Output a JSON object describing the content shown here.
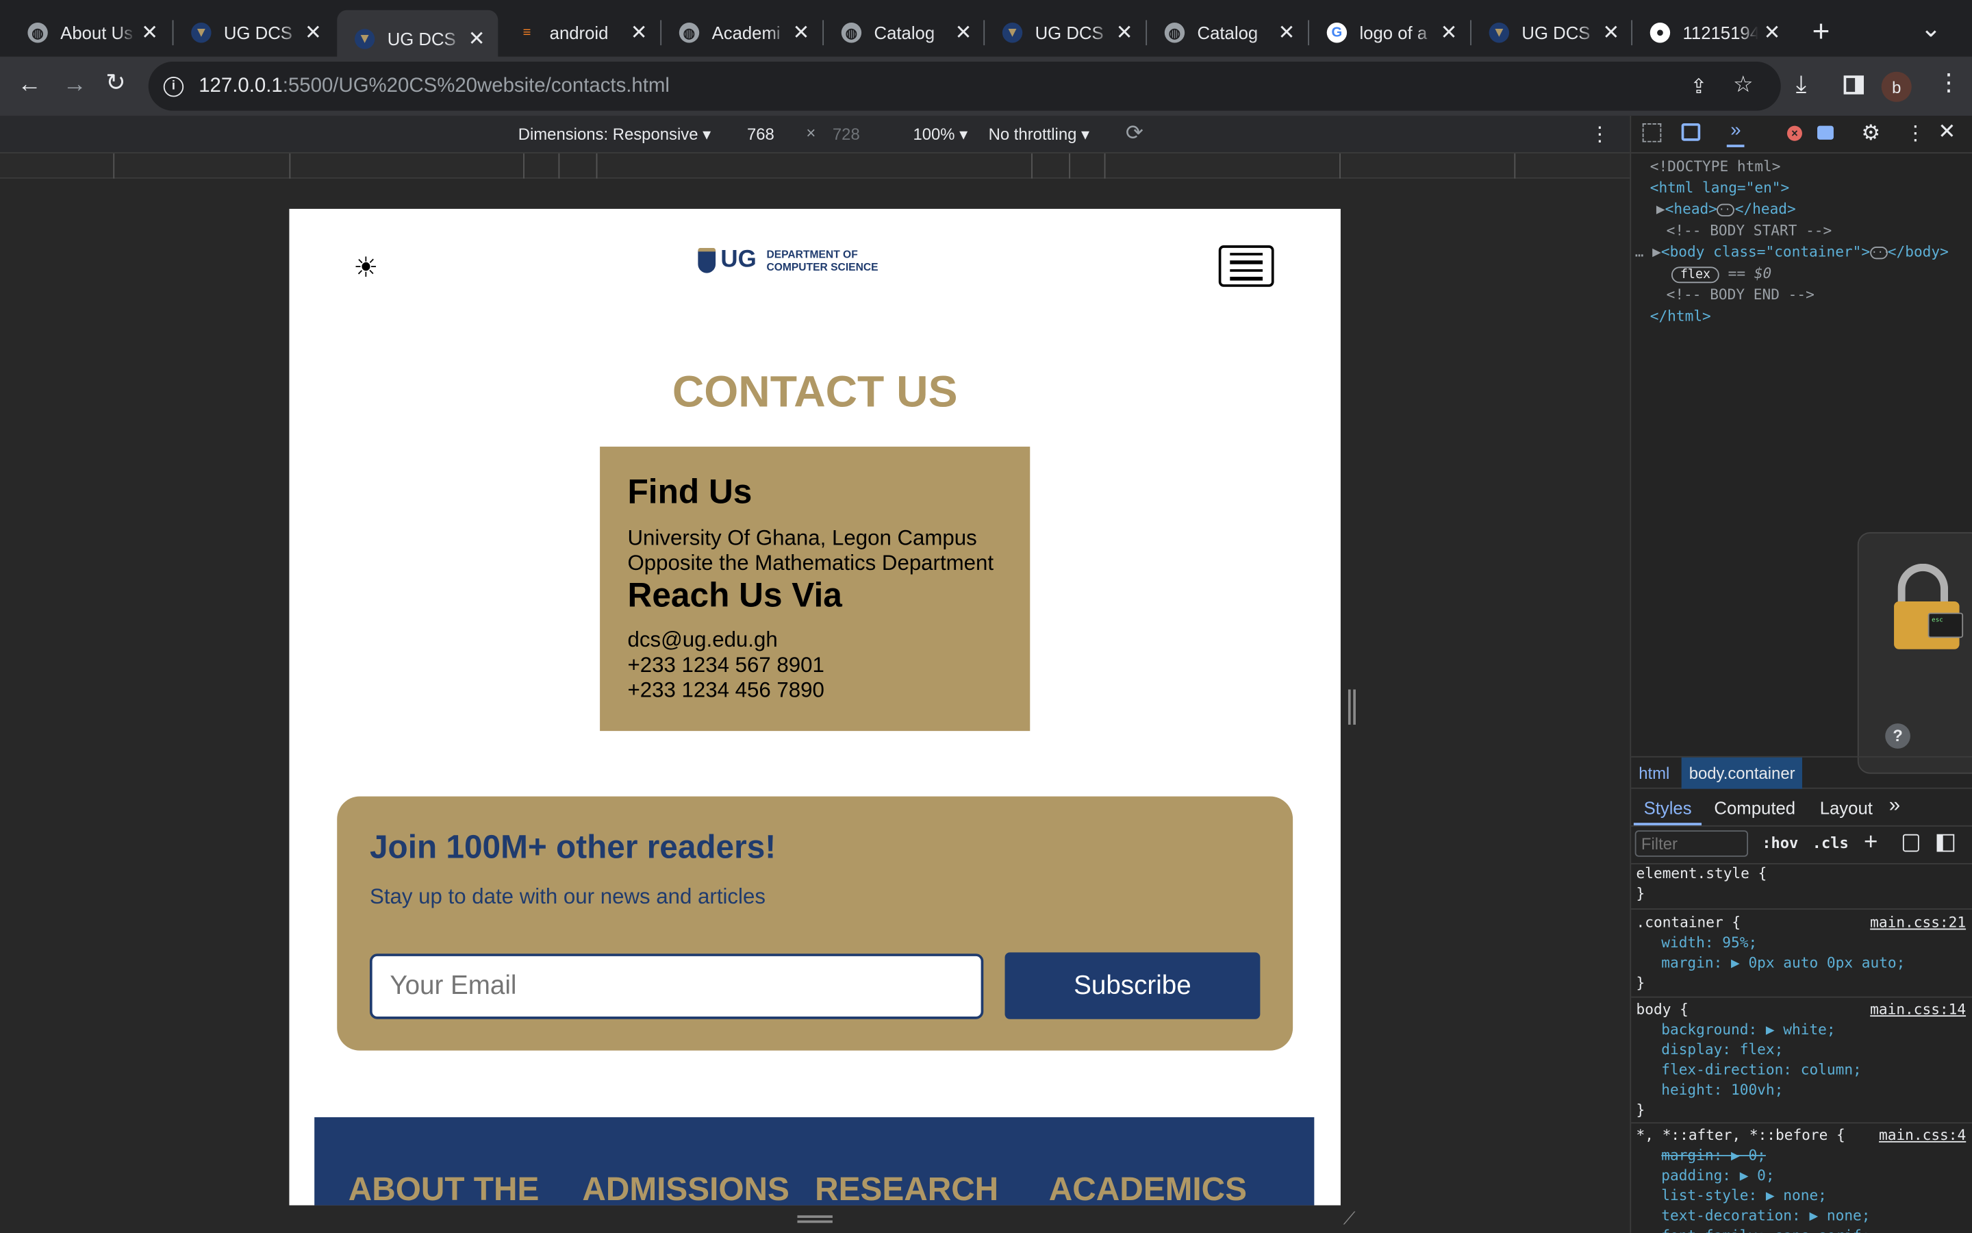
{
  "browser": {
    "tabs": [
      {
        "title": "About Us",
        "icon": "globe-icon"
      },
      {
        "title": "UG DCS",
        "icon": "ug-crest-icon"
      },
      {
        "title": "UG DCS",
        "icon": "ug-crest-icon",
        "active": true
      },
      {
        "title": "android",
        "icon": "stackoverflow-icon"
      },
      {
        "title": "Academi",
        "icon": "globe-icon"
      },
      {
        "title": "Catalog",
        "icon": "globe-icon"
      },
      {
        "title": "UG DCS",
        "icon": "ug-crest-icon"
      },
      {
        "title": "Catalog",
        "icon": "globe-icon"
      },
      {
        "title": "logo of a",
        "icon": "google-icon"
      },
      {
        "title": "UG DCS",
        "icon": "ug-crest-icon"
      },
      {
        "title": "11215194",
        "icon": "github-icon"
      }
    ],
    "url_host": "127.0.0.1",
    "url_path": ":5500/UG%20CS%20website/contacts.html",
    "profile_initial": "b"
  },
  "device_toolbar": {
    "dimensions_label": "Dimensions: Responsive",
    "width": "768",
    "times": "×",
    "height": "728",
    "zoom": "100%",
    "throttling": "No throttling"
  },
  "page": {
    "logo_text": "UG",
    "logo_sub_line1": "DEPARTMENT OF",
    "logo_sub_line2": "COMPUTER SCIENCE",
    "heading": "CONTACT US",
    "find_us_title": "Find Us",
    "address_line1": "University Of Ghana, Legon Campus",
    "address_line2": "Opposite the Mathematics Department",
    "reach_title": "Reach Us Via",
    "email": "dcs@ug.edu.gh",
    "phone1": "+233 1234 567 8901",
    "phone2": "+233 1234 456 7890",
    "newsletter_title": "Join 100M+ other readers!",
    "newsletter_sub": "Stay up to date with our news and articles",
    "email_placeholder": "Your Email",
    "subscribe_label": "Subscribe",
    "footer_links": [
      "ABOUT THE",
      "ADMISSIONS",
      "RESEARCH",
      "ACADEMICS"
    ],
    "colors": {
      "gold": "#b09865",
      "navy": "#1f3b6e",
      "white": "#ffffff"
    }
  },
  "devtools": {
    "elements": [
      "<!DOCTYPE html>",
      "<html lang=\"en\">",
      "<head>",
      "</head>",
      "<!-- BODY START -->",
      "<body class=\"container\">",
      "</body>",
      "flex",
      "== $0",
      "<!-- BODY END -->",
      "</html>"
    ],
    "breadcrumbs": [
      "html",
      "body.container"
    ],
    "tabs": [
      "Styles",
      "Computed",
      "Layout"
    ],
    "filter_placeholder": "Filter",
    "hov": ":hov",
    "cls": ".cls",
    "rules": {
      "element_style": "element.style {",
      "close": "}",
      "container_selector": ".container {",
      "container_src": "main.css:21",
      "container_decls": [
        "width: 95%;",
        "margin: ▶ 0px auto 0px auto;"
      ],
      "body_selector": "body {",
      "body_src": "main.css:14",
      "body_decls": [
        "background: ▶ white;",
        "display: flex;",
        "flex-direction: column;",
        "height: 100vh;"
      ],
      "universal_selector": "*, *::after, *::before {",
      "universal_src": "main.css:4",
      "universal_decls": [
        "margin: ▶ 0;",
        "padding: ▶ 0;",
        "list-style: ▶ none;",
        "text-decoration: ▶ none;",
        "font-family: sans-serif;"
      ]
    }
  }
}
